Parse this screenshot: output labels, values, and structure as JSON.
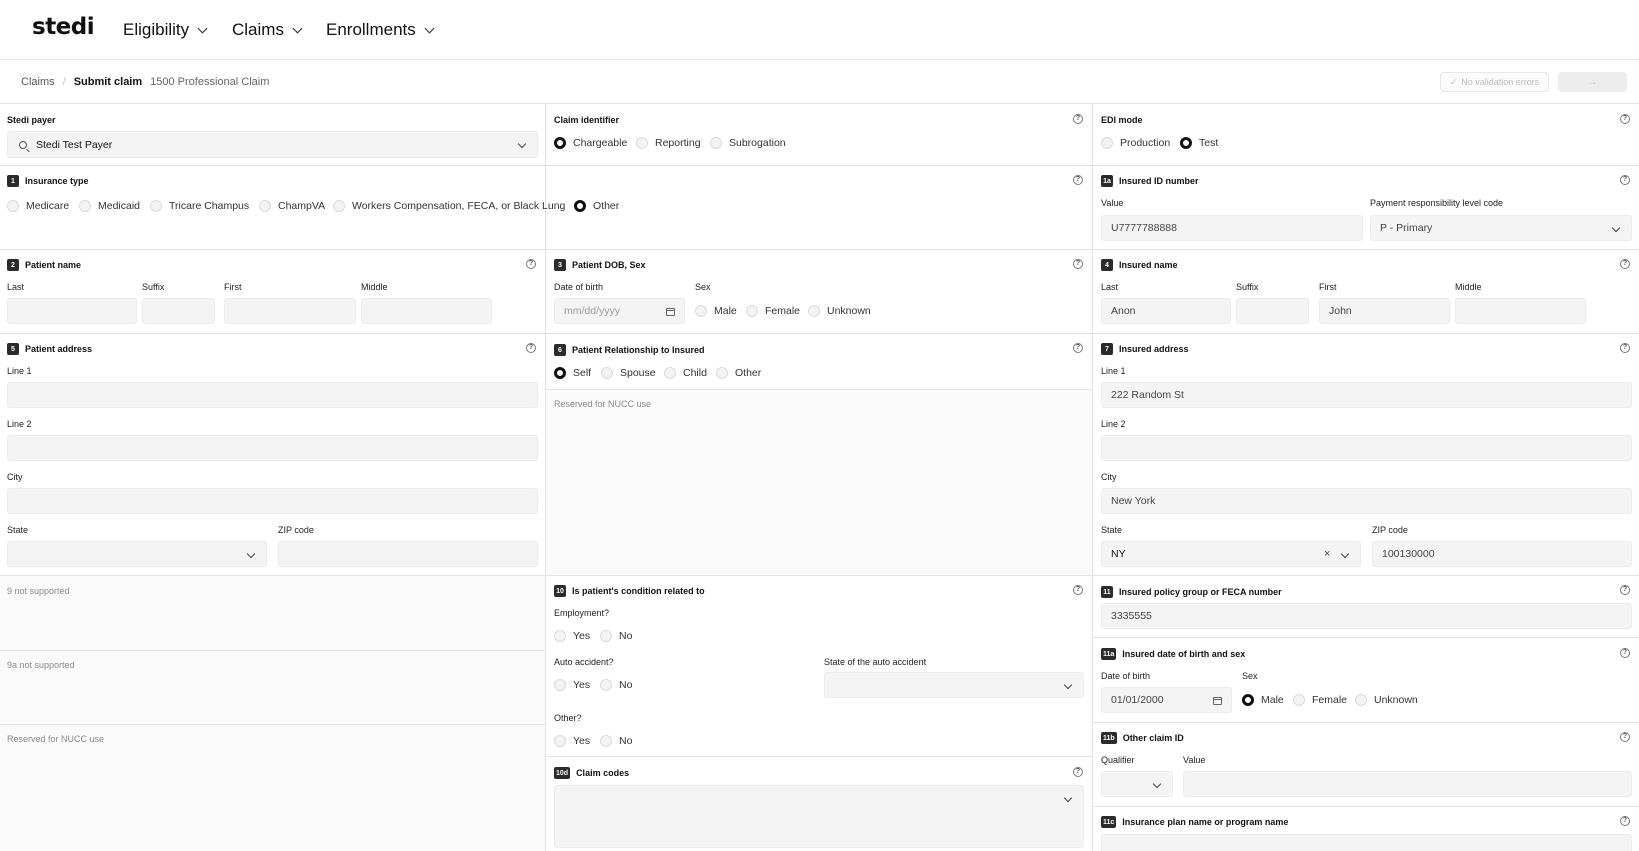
{
  "nav": {
    "logo": "stedi",
    "items": [
      "Eligibility",
      "Claims",
      "Enrollments"
    ]
  },
  "breadcrumb": {
    "root": "Claims",
    "current": "Submit claim",
    "subtitle": "1500 Professional Claim"
  },
  "toolbar": {
    "validation": "No validation errors",
    "submit": "→"
  },
  "payer": {
    "title": "Stedi payer",
    "value": "Stedi Test Payer"
  },
  "claim_identifier": {
    "title": "Claim identifier",
    "options": [
      "Chargeable",
      "Reporting",
      "Subrogation"
    ]
  },
  "edi_mode": {
    "title": "EDI mode",
    "options": [
      "Production",
      "Test"
    ]
  },
  "insurance_type": {
    "badge": "1",
    "title": "Insurance type",
    "options": [
      "Medicare",
      "Medicaid",
      "Tricare Champus",
      "ChampVA",
      "Workers Compensation, FECA, or Black Lung",
      "Other"
    ]
  },
  "insured_id": {
    "badge": "1a",
    "title": "Insured ID number",
    "value_label": "Value",
    "value": "U7777788888",
    "level_label": "Payment responsibility level code",
    "level_value": "P - Primary"
  },
  "patient_name": {
    "badge": "2",
    "title": "Patient name",
    "labels": [
      "Last",
      "Suffix",
      "First",
      "Middle"
    ]
  },
  "patient_dob": {
    "badge": "3",
    "title": "Patient DOB, Sex",
    "dob_label": "Date of birth",
    "dob_placeholder": "mm/dd/yyyy",
    "sex_label": "Sex",
    "sex_options": [
      "Male",
      "Female",
      "Unknown"
    ]
  },
  "insured_name": {
    "badge": "4",
    "title": "Insured name",
    "labels": [
      "Last",
      "Suffix",
      "First",
      "Middle"
    ],
    "last": "Anon",
    "first": "John"
  },
  "patient_address": {
    "badge": "5",
    "title": "Patient address",
    "line1": "Line 1",
    "line2": "Line 2",
    "city": "City",
    "state": "State",
    "zip": "ZIP code"
  },
  "relationship": {
    "badge": "6",
    "title": "Patient Relationship to Insured",
    "options": [
      "Self",
      "Spouse",
      "Child",
      "Other"
    ],
    "reserved": "Reserved for NUCC use"
  },
  "insured_address": {
    "badge": "7",
    "title": "Insured address",
    "line1_label": "Line 1",
    "line1": "222 Random St",
    "line2_label": "Line 2",
    "city_label": "City",
    "city": "New York",
    "state_label": "State",
    "state": "NY",
    "zip_label": "ZIP code",
    "zip": "100130000"
  },
  "unsupported": {
    "box9": "9 not supported",
    "box9a": "9a not supported",
    "reserved": "Reserved for NUCC use"
  },
  "condition": {
    "badge": "10",
    "title": "Is patient's condition related to",
    "employment": "Employment?",
    "auto": "Auto accident?",
    "auto_state": "State of the auto accident",
    "other": "Other?",
    "yes": "Yes",
    "no": "No"
  },
  "claim_codes": {
    "badge": "10d",
    "title": "Claim codes"
  },
  "policy_group": {
    "badge": "11",
    "title": "Insured policy group or FECA number",
    "value": "3335555"
  },
  "insured_dob": {
    "badge": "11a",
    "title": "Insured date of birth and sex",
    "dob_label": "Date of birth",
    "dob": "01/01/2000",
    "sex_label": "Sex",
    "sex_options": [
      "Male",
      "Female",
      "Unknown"
    ]
  },
  "other_claim": {
    "badge": "11b",
    "title": "Other claim ID",
    "qualifier": "Qualifier",
    "value": "Value"
  },
  "plan_name": {
    "badge": "11c",
    "title": "Insurance plan name or program name"
  },
  "colors": {
    "accent": "#111111",
    "border": "#e3e3e3",
    "input_bg": "#f4f4f4",
    "panel_bg": "#fafafa"
  }
}
